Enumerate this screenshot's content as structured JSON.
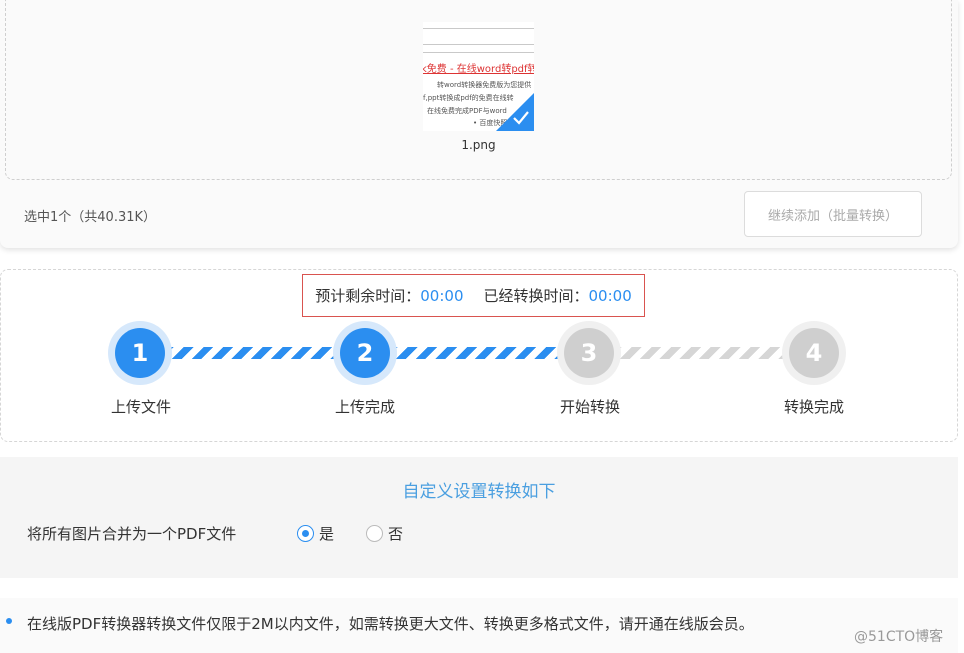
{
  "upload": {
    "thumbnail": {
      "title_text": "k免费 - 在线word转pdf转",
      "rows": [
        "转word转换器免费版为您提供",
        "f,ppt转换成pdf的免费在线转",
        "在线免费完成PDF与word",
        "• 百度快照"
      ]
    },
    "file_name": "1.png",
    "selected_info": "选中1个（共40.31K）",
    "add_button_label": "继续添加（批量转换）"
  },
  "timer": {
    "remaining_label": "预计剩余时间：",
    "remaining_value": "00:00",
    "elapsed_label": "已经转换时间：",
    "elapsed_value": "00:00"
  },
  "steps": [
    {
      "number": "1",
      "label": "上传文件",
      "state": "done"
    },
    {
      "number": "2",
      "label": "上传完成",
      "state": "done"
    },
    {
      "number": "3",
      "label": "开始转换",
      "state": "pending"
    },
    {
      "number": "4",
      "label": "转换完成",
      "state": "pending"
    }
  ],
  "settings": {
    "title": "自定义设置转换如下",
    "merge_label": "将所有图片合并为一个PDF文件",
    "option_yes": "是",
    "option_no": "否",
    "selected": "是"
  },
  "notice": {
    "text": "在线版PDF转换器转换文件仅限于2M以内文件，如需转换更大文件、转换更多格式文件，请开通在线版会员。"
  },
  "watermark": "@51CTO博客",
  "colors": {
    "accent": "#2b8ef0",
    "timer_border": "#d9534f",
    "settings_title": "#4a9fe0"
  }
}
